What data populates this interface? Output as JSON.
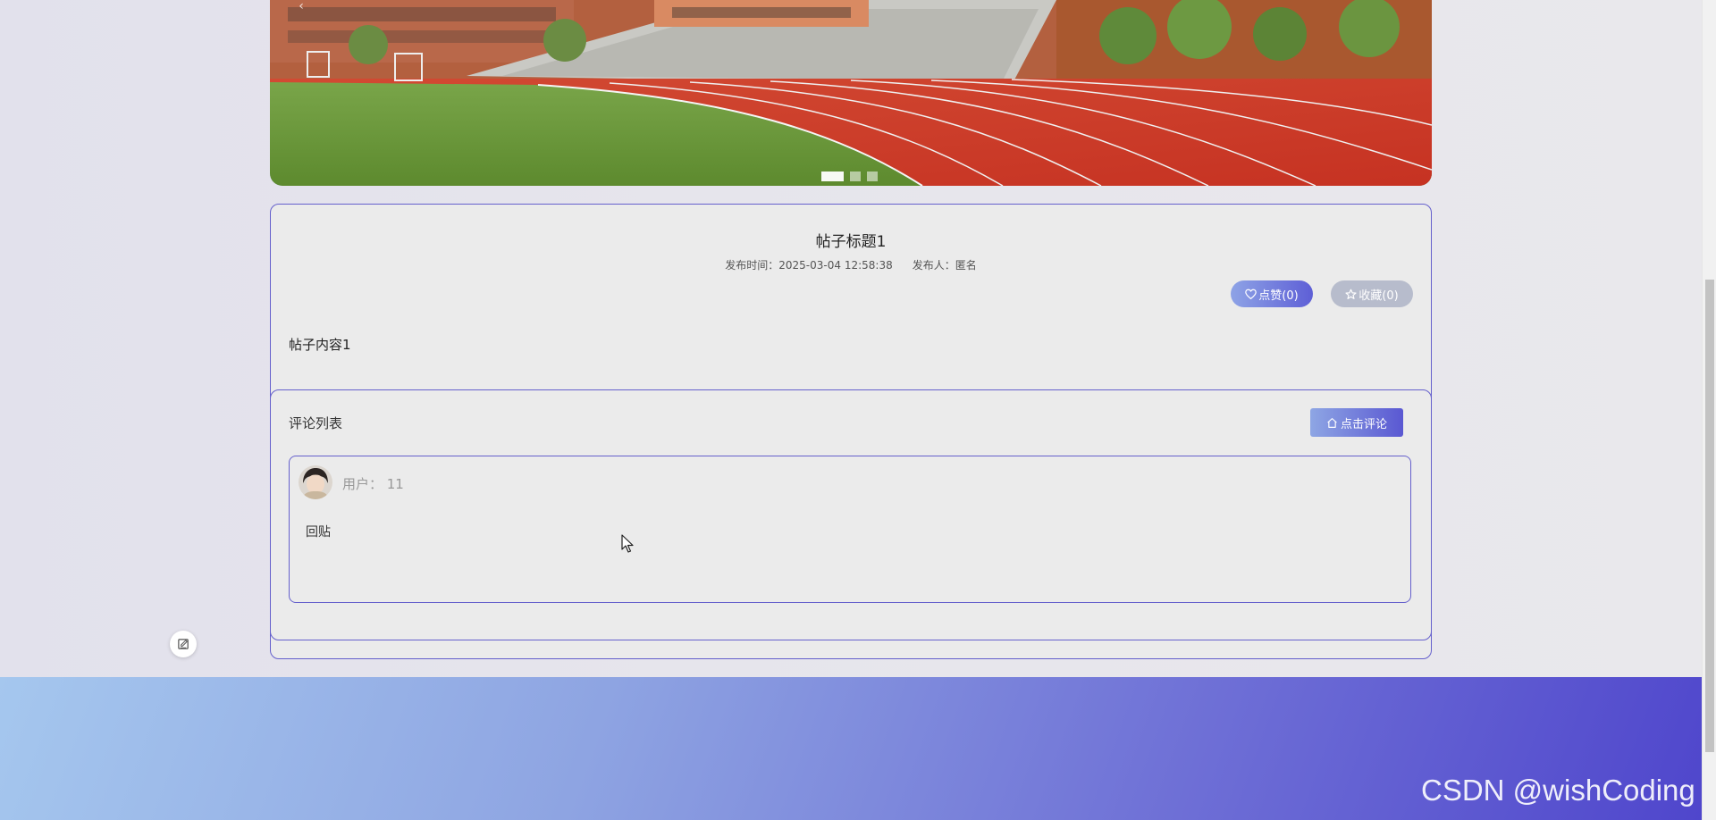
{
  "banner": {
    "dots": 3,
    "active_dot": 1,
    "prev_glyph": "‹"
  },
  "post": {
    "title": "帖子标题1",
    "publish_time_label": "发布时间：",
    "publish_time": "2025-03-04 12:58:38",
    "publisher_label": "发布人：",
    "publisher": "匿名",
    "like_label": "点赞(0)",
    "favorite_label": "收藏(0)",
    "content": "帖子内容1"
  },
  "comments": {
    "heading": "评论列表",
    "add_button_label": "点击评论",
    "items": [
      {
        "user": "用户：  11",
        "text": "回贴"
      }
    ]
  },
  "watermark": "CSDN @wishCoding",
  "colors": {
    "accent_border": "#6560cc",
    "like_gradient_start": "#8ea3e6",
    "like_gradient_end": "#5e5fd6",
    "favorite_bg": "#b7bccc",
    "footer_gradient_start": "#a5c7ee",
    "footer_gradient_end": "#4f46cc"
  },
  "icons": {
    "like": "heart-icon",
    "favorite": "star-icon",
    "comment": "home-icon",
    "float": "edit-icon"
  }
}
